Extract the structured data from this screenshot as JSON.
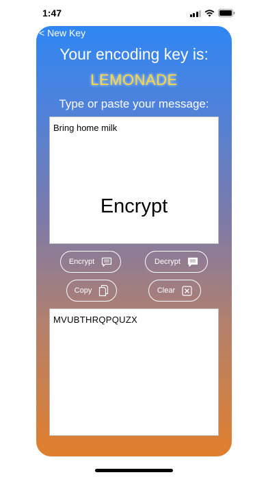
{
  "status_bar": {
    "time": "1:47"
  },
  "nav": {
    "back_label": "< New Key"
  },
  "key": {
    "heading": "Your encoding key is:",
    "value": "LEMONADE"
  },
  "input": {
    "prompt": "Type or paste your message:",
    "message": "Bring home milk",
    "overlay_action": "Encrypt"
  },
  "buttons": {
    "encrypt": "Encrypt",
    "decrypt": "Decrypt",
    "copy": "Copy",
    "clear": "Clear"
  },
  "output": {
    "text": "MVUBTHRQPQUZX"
  },
  "colors": {
    "gradient_top": "#2f86f3",
    "gradient_bottom": "#e07f2c",
    "key_highlight": "#ffd83d"
  }
}
